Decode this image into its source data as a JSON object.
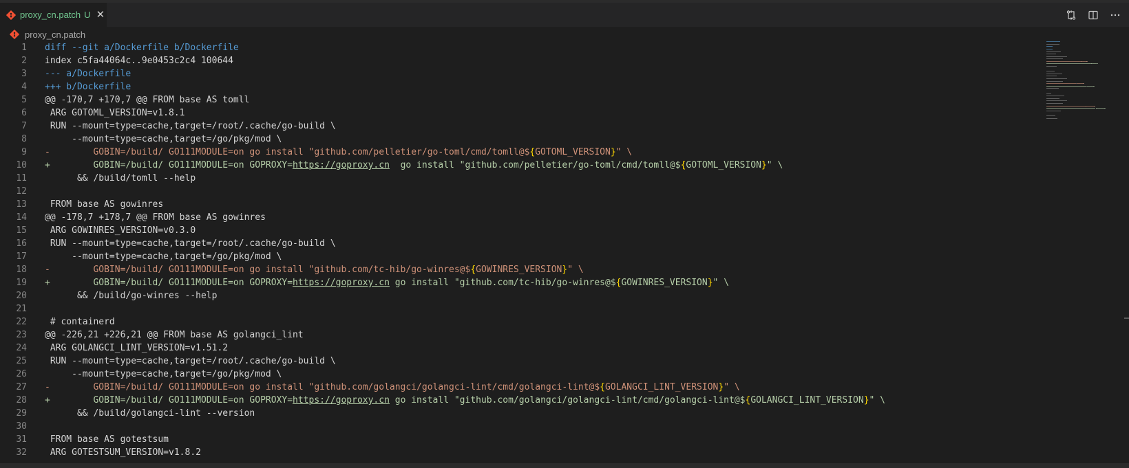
{
  "tab": {
    "label": "proxy_cn.patch",
    "status": "U",
    "close_glyph": "✕"
  },
  "breadcrumb": {
    "label": "proxy_cn.patch"
  },
  "actions": [
    {
      "name": "open-changes-icon"
    },
    {
      "name": "split-editor-icon"
    },
    {
      "name": "more-actions-icon"
    }
  ],
  "colors": {
    "header": "#569cd6",
    "removed": "#ce9178",
    "added": "#b5cea8",
    "text": "#d4d4d4",
    "line_number": "#858585",
    "modified_tab": "#73c991",
    "git_icon": "#f05033"
  },
  "lines": [
    {
      "n": "1",
      "segs": [
        {
          "t": "diff --git a/Dockerfile b/Dockerfile",
          "c": "hdr"
        }
      ]
    },
    {
      "n": "2",
      "segs": [
        {
          "t": "index c5fa44064c..9e0453c2c4 100644",
          "c": ""
        }
      ]
    },
    {
      "n": "3",
      "segs": [
        {
          "t": "--- a/Dockerfile",
          "c": "hdr"
        }
      ]
    },
    {
      "n": "4",
      "segs": [
        {
          "t": "+++ b/Dockerfile",
          "c": "hdr"
        }
      ]
    },
    {
      "n": "5",
      "segs": [
        {
          "t": "@@ -170,7 +170,7 @@ FROM base AS tomll",
          "c": ""
        }
      ]
    },
    {
      "n": "6",
      "segs": [
        {
          "t": " ARG GOTOML_VERSION=v1.8.1",
          "c": ""
        }
      ]
    },
    {
      "n": "7",
      "segs": [
        {
          "t": " RUN --mount=type=cache,target=/root/.cache/go-build \\",
          "c": ""
        }
      ]
    },
    {
      "n": "8",
      "segs": [
        {
          "t": "     --mount=type=cache,target=/go/pkg/mod \\",
          "c": ""
        }
      ]
    },
    {
      "n": "9",
      "segs": [
        {
          "t": "-        GOBIN=/build/ GO111MODULE=on go install \"github.com/pelletier/go-toml/cmd/tomll@$",
          "c": "del"
        },
        {
          "t": "{",
          "c": "brace"
        },
        {
          "t": "GOTOML_VERSION",
          "c": "del"
        },
        {
          "t": "}",
          "c": "brace"
        },
        {
          "t": "\" \\",
          "c": "del"
        }
      ]
    },
    {
      "n": "10",
      "segs": [
        {
          "t": "+        GOBIN=/build/ GO111MODULE=on GOPROXY=",
          "c": "add"
        },
        {
          "t": "https://goproxy.cn",
          "c": "add url"
        },
        {
          "t": "  go install \"github.com/pelletier/go-toml/cmd/tomll@$",
          "c": "add"
        },
        {
          "t": "{",
          "c": "brace"
        },
        {
          "t": "GOTOML_VERSION",
          "c": "add"
        },
        {
          "t": "}",
          "c": "brace"
        },
        {
          "t": "\" \\",
          "c": "add"
        }
      ]
    },
    {
      "n": "11",
      "segs": [
        {
          "t": "      && /build/tomll --help",
          "c": ""
        }
      ]
    },
    {
      "n": "12",
      "segs": [
        {
          "t": "",
          "c": ""
        }
      ]
    },
    {
      "n": "13",
      "segs": [
        {
          "t": " FROM base AS gowinres",
          "c": ""
        }
      ]
    },
    {
      "n": "14",
      "segs": [
        {
          "t": "@@ -178,7 +178,7 @@ FROM base AS gowinres",
          "c": ""
        }
      ]
    },
    {
      "n": "15",
      "segs": [
        {
          "t": " ARG GOWINRES_VERSION=v0.3.0",
          "c": ""
        }
      ]
    },
    {
      "n": "16",
      "segs": [
        {
          "t": " RUN --mount=type=cache,target=/root/.cache/go-build \\",
          "c": ""
        }
      ]
    },
    {
      "n": "17",
      "segs": [
        {
          "t": "     --mount=type=cache,target=/go/pkg/mod \\",
          "c": ""
        }
      ]
    },
    {
      "n": "18",
      "segs": [
        {
          "t": "-        GOBIN=/build/ GO111MODULE=on go install \"github.com/tc-hib/go-winres@$",
          "c": "del"
        },
        {
          "t": "{",
          "c": "brace"
        },
        {
          "t": "GOWINRES_VERSION",
          "c": "del"
        },
        {
          "t": "}",
          "c": "brace"
        },
        {
          "t": "\" \\",
          "c": "del"
        }
      ]
    },
    {
      "n": "19",
      "segs": [
        {
          "t": "+        GOBIN=/build/ GO111MODULE=on GOPROXY=",
          "c": "add"
        },
        {
          "t": "https://goproxy.cn",
          "c": "add url"
        },
        {
          "t": " go install \"github.com/tc-hib/go-winres@$",
          "c": "add"
        },
        {
          "t": "{",
          "c": "brace"
        },
        {
          "t": "GOWINRES_VERSION",
          "c": "add"
        },
        {
          "t": "}",
          "c": "brace"
        },
        {
          "t": "\" \\",
          "c": "add"
        }
      ]
    },
    {
      "n": "20",
      "segs": [
        {
          "t": "      && /build/go-winres --help",
          "c": ""
        }
      ]
    },
    {
      "n": "21",
      "segs": [
        {
          "t": "",
          "c": ""
        }
      ]
    },
    {
      "n": "22",
      "segs": [
        {
          "t": " # containerd",
          "c": ""
        }
      ]
    },
    {
      "n": "23",
      "segs": [
        {
          "t": "@@ -226,21 +226,21 @@ FROM base AS golangci_lint",
          "c": ""
        }
      ]
    },
    {
      "n": "24",
      "segs": [
        {
          "t": " ARG GOLANGCI_LINT_VERSION=v1.51.2",
          "c": ""
        }
      ]
    },
    {
      "n": "25",
      "segs": [
        {
          "t": " RUN --mount=type=cache,target=/root/.cache/go-build \\",
          "c": ""
        }
      ]
    },
    {
      "n": "26",
      "segs": [
        {
          "t": "     --mount=type=cache,target=/go/pkg/mod \\",
          "c": ""
        }
      ]
    },
    {
      "n": "27",
      "segs": [
        {
          "t": "-        GOBIN=/build/ GO111MODULE=on go install \"github.com/golangci/golangci-lint/cmd/golangci-lint@$",
          "c": "del"
        },
        {
          "t": "{",
          "c": "brace"
        },
        {
          "t": "GOLANGCI_LINT_VERSION",
          "c": "del"
        },
        {
          "t": "}",
          "c": "brace"
        },
        {
          "t": "\" \\",
          "c": "del"
        }
      ]
    },
    {
      "n": "28",
      "segs": [
        {
          "t": "+        GOBIN=/build/ GO111MODULE=on GOPROXY=",
          "c": "add"
        },
        {
          "t": "https://goproxy.cn",
          "c": "add url"
        },
        {
          "t": " go install \"github.com/golangci/golangci-lint/cmd/golangci-lint@$",
          "c": "add"
        },
        {
          "t": "{",
          "c": "brace"
        },
        {
          "t": "GOLANGCI_LINT_VERSION",
          "c": "add"
        },
        {
          "t": "}",
          "c": "brace"
        },
        {
          "t": "\" \\",
          "c": "add"
        }
      ]
    },
    {
      "n": "29",
      "segs": [
        {
          "t": "      && /build/golangci-lint --version",
          "c": ""
        }
      ]
    },
    {
      "n": "30",
      "segs": [
        {
          "t": "",
          "c": ""
        }
      ]
    },
    {
      "n": "31",
      "segs": [
        {
          "t": " FROM base AS gotestsum",
          "c": ""
        }
      ]
    },
    {
      "n": "32",
      "segs": [
        {
          "t": " ARG GOTESTSUM_VERSION=v1.8.2",
          "c": ""
        }
      ]
    }
  ]
}
